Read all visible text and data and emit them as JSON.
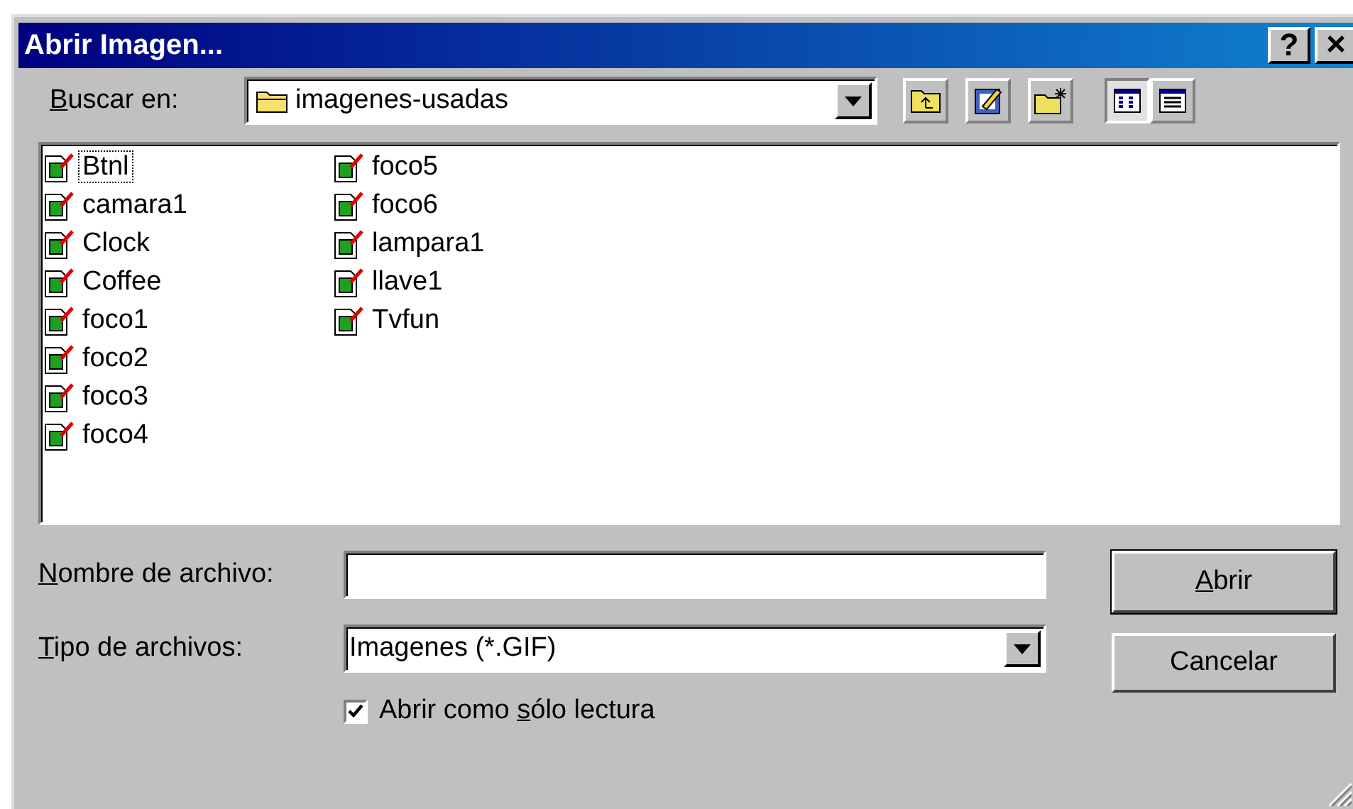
{
  "window": {
    "title": "Abrir Imagen...",
    "title_buttons": [
      {
        "kind": "help",
        "label": "?"
      },
      {
        "kind": "close",
        "label": "×"
      }
    ]
  },
  "look_in": {
    "label": {
      "key": "B",
      "rest": "uscar en:"
    },
    "value": "imagenes-usadas"
  },
  "toolbar": [
    {
      "kind": "up",
      "selected": false
    },
    {
      "kind": "favorites",
      "selected": false
    },
    {
      "kind": "new-folder",
      "selected": false
    },
    {
      "kind": "list",
      "selected": true
    },
    {
      "kind": "details",
      "selected": false
    }
  ],
  "files": [
    {
      "name": "Btnl",
      "selected": true
    },
    {
      "name": "camara1",
      "selected": false
    },
    {
      "name": "Clock",
      "selected": false
    },
    {
      "name": "Coffee",
      "selected": false
    },
    {
      "name": "foco1",
      "selected": false
    },
    {
      "name": "foco2",
      "selected": false
    },
    {
      "name": "foco3",
      "selected": false
    },
    {
      "name": "foco4",
      "selected": false
    },
    {
      "name": "foco5",
      "selected": false
    },
    {
      "name": "foco6",
      "selected": false
    },
    {
      "name": "lampara1",
      "selected": false
    },
    {
      "name": "llave1",
      "selected": false
    },
    {
      "name": "Tvfun",
      "selected": false
    }
  ],
  "file_name": {
    "label": {
      "key": "N",
      "rest": "ombre de archivo:"
    }
  },
  "file_type": {
    "label": {
      "key": "T",
      "rest": "ipo de archivos:"
    },
    "value": "Imagenes (*.GIF)"
  },
  "read_only": {
    "label": {
      "before": "Abrir como ",
      "key": "s",
      "rest": "ólo lectura"
    },
    "checked": true
  },
  "buttons": [
    {
      "label": {
        "key": "A",
        "rest": "brir"
      },
      "default": true
    },
    {
      "label": {
        "rest": "Cancelar"
      },
      "default": false
    }
  ]
}
